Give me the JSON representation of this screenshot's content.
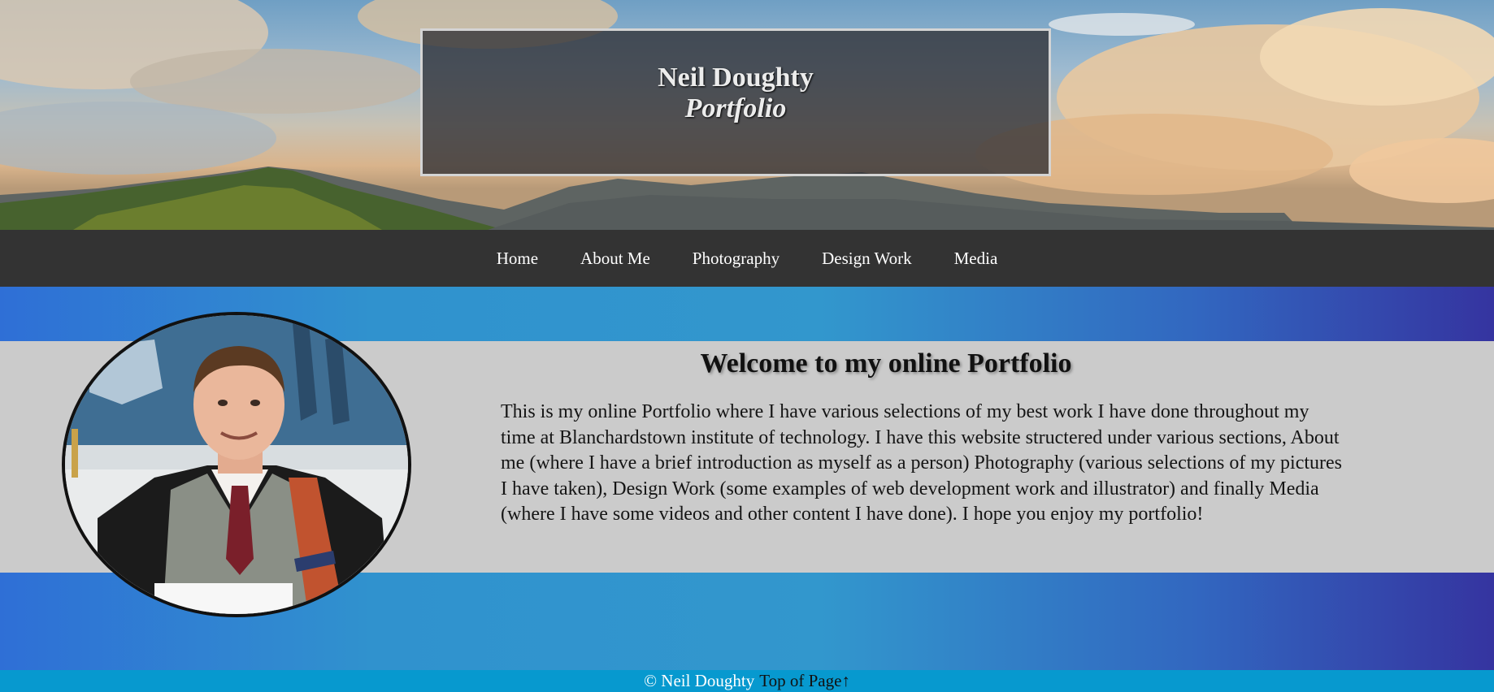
{
  "header": {
    "name": "Neil Doughty",
    "subtitle": "Portfolio"
  },
  "nav": {
    "items": [
      "Home",
      "About Me",
      "Photography",
      "Design Work",
      "Media"
    ]
  },
  "main": {
    "heading": "Welcome to my online Portfolio",
    "intro": "This is my online Portfolio where I have various selections of my best work I have done throughout my time at Blanchardstown institute of technology. I have this website structered under various sections, About me (where I have a brief introduction as myself as a person) Photography (various selections of my pictures I have taken), Design Work (some examples of web development work and illustrator) and finally Media (where I have some videos and other content I have done). I hope you enjoy my portfolio!"
  },
  "footer": {
    "copyright": "© Neil Doughty",
    "top_link": "Top of Page↑"
  },
  "colors": {
    "nav_bg": "#333333",
    "band_bg": "#cbcbcb",
    "footer_bg": "#0799cf",
    "gradient_start": "#2f6fd6",
    "gradient_end": "#3534a0"
  }
}
